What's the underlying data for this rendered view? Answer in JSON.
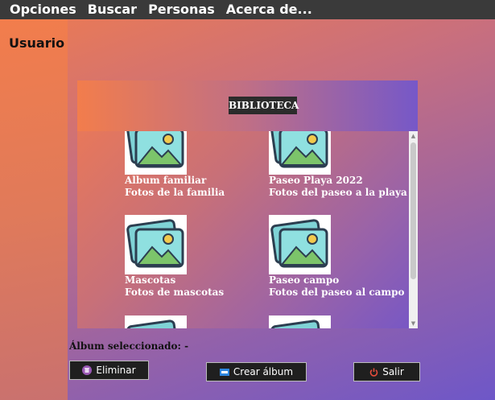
{
  "menu": {
    "items": [
      "Opciones",
      "Buscar",
      "Personas",
      "Acerca de..."
    ]
  },
  "sidebar": {
    "user_label": "Usuario"
  },
  "library": {
    "title": "BIBLIOTECA",
    "albums": [
      {
        "name": "Album familiar",
        "description": "Fotos de la familia"
      },
      {
        "name": "Paseo Playa 2022",
        "description": "Fotos del paseo a la playa"
      },
      {
        "name": "Mascotas",
        "description": "Fotos de mascotas"
      },
      {
        "name": "Paseo campo",
        "description": "Fotos del paseo al campo"
      }
    ]
  },
  "selection": {
    "label": "Álbum seleccionado: -"
  },
  "buttons": {
    "delete": "Eliminar",
    "create": "Crear álbum",
    "exit": "Salir"
  },
  "icons": {
    "album_thumbnail": "image-gallery-icon",
    "delete": "trash-icon",
    "create": "new-icon",
    "exit": "power-icon"
  }
}
